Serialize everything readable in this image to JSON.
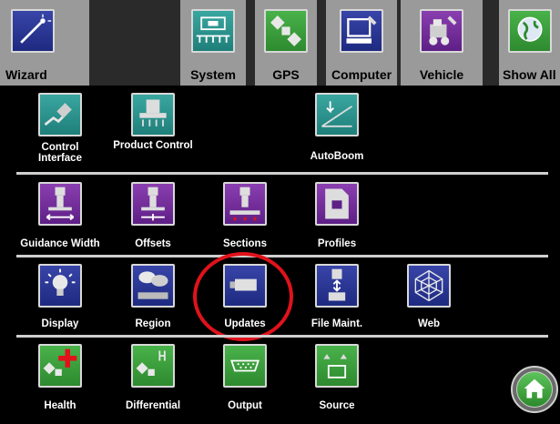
{
  "tabs": [
    {
      "label": "Wizard"
    },
    {
      "label": "System"
    },
    {
      "label": "GPS"
    },
    {
      "label": "Computer"
    },
    {
      "label": "Vehicle"
    },
    {
      "label": "Show All"
    }
  ],
  "rows": [
    [
      {
        "label": "Control\nInterface",
        "icon": "control-interface-icon"
      },
      {
        "label": "Product Control",
        "icon": "product-control-icon"
      },
      {
        "label": "AutoBoom",
        "icon": "autoboom-icon"
      }
    ],
    [
      {
        "label": "Guidance Width",
        "icon": "guidance-width-icon"
      },
      {
        "label": "Offsets",
        "icon": "offsets-icon"
      },
      {
        "label": "Sections",
        "icon": "sections-icon"
      },
      {
        "label": "Profiles",
        "icon": "profiles-icon"
      }
    ],
    [
      {
        "label": "Display",
        "icon": "lightbulb-icon"
      },
      {
        "label": "Region",
        "icon": "region-icon"
      },
      {
        "label": "Updates",
        "icon": "usb-drive-icon"
      },
      {
        "label": "File Maint.",
        "icon": "file-transfer-icon"
      },
      {
        "label": "Web",
        "icon": "spider-web-icon"
      }
    ],
    [
      {
        "label": "Health",
        "icon": "health-satellite-icon"
      },
      {
        "label": "Differential",
        "icon": "differential-satellite-icon"
      },
      {
        "label": "Output",
        "icon": "serial-port-icon"
      },
      {
        "label": "Source",
        "icon": "source-icon"
      }
    ]
  ],
  "colors": {
    "highlight_circle": "#e0121b",
    "accent_green": "#3d9e3c",
    "purple": "#6b2a93",
    "teal": "#2b8f89"
  }
}
